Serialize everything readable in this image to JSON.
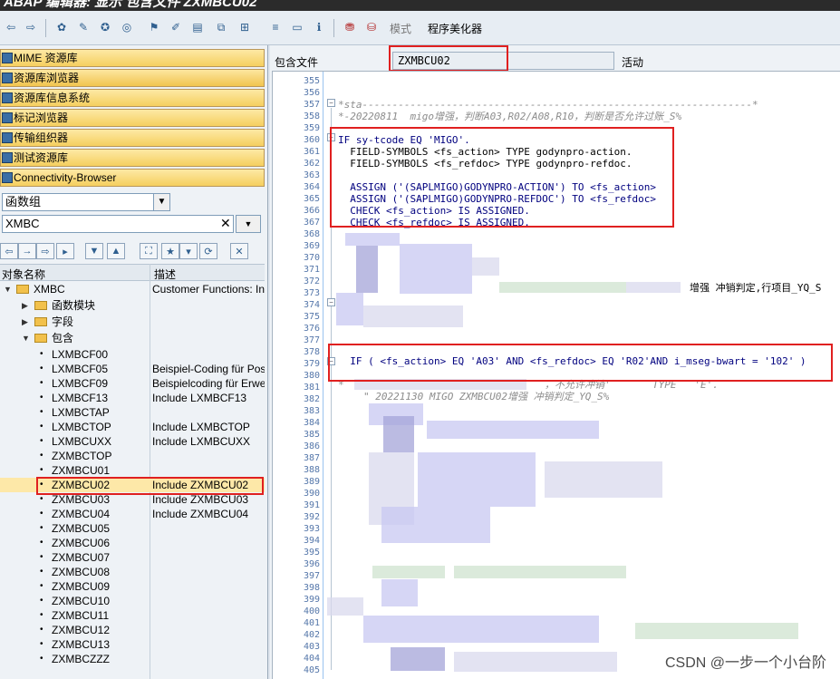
{
  "window": {
    "title": "ABAP 编辑器: 显示 包含文件 ZXMBCU02"
  },
  "toolbar": {
    "mode_label": "模式",
    "pretty_printer_label": "程序美化器"
  },
  "left_nav": {
    "items": [
      {
        "label": "MIME 资源库"
      },
      {
        "label": "资源库浏览器"
      },
      {
        "label": "资源库信息系统"
      },
      {
        "label": "标记浏览器"
      },
      {
        "label": "传输组织器"
      },
      {
        "label": "测试资源库"
      },
      {
        "label": "Connectivity-Browser"
      }
    ],
    "object_type": "函数组",
    "search_value": "XMBC"
  },
  "tree": {
    "col_name": "对象名称",
    "col_desc": "描述",
    "rows": [
      {
        "name": "XMBC",
        "desc": "Customer Functions: In"
      },
      {
        "name": "函数模块",
        "desc": ""
      },
      {
        "name": "字段",
        "desc": ""
      },
      {
        "name": "包含",
        "desc": ""
      },
      {
        "name": "LXMBCF00",
        "desc": ""
      },
      {
        "name": "LXMBCF05",
        "desc": "Beispiel-Coding für Posi"
      },
      {
        "name": "LXMBCF09",
        "desc": "Beispielcoding für Erwe"
      },
      {
        "name": "LXMBCF13",
        "desc": "Include LXMBCF13"
      },
      {
        "name": "LXMBCTAP",
        "desc": ""
      },
      {
        "name": "LXMBCTOP",
        "desc": "Include LXMBCTOP"
      },
      {
        "name": "LXMBCUXX",
        "desc": "Include LXMBCUXX"
      },
      {
        "name": "ZXMBCTOP",
        "desc": ""
      },
      {
        "name": "ZXMBCU01",
        "desc": ""
      },
      {
        "name": "ZXMBCU02",
        "desc": "Include ZXMBCU02"
      },
      {
        "name": "ZXMBCU03",
        "desc": "Include ZXMBCU03"
      },
      {
        "name": "ZXMBCU04",
        "desc": "Include ZXMBCU04"
      },
      {
        "name": "ZXMBCU05",
        "desc": ""
      },
      {
        "name": "ZXMBCU06",
        "desc": ""
      },
      {
        "name": "ZXMBCU07",
        "desc": ""
      },
      {
        "name": "ZXMBCU08",
        "desc": ""
      },
      {
        "name": "ZXMBCU09",
        "desc": ""
      },
      {
        "name": "ZXMBCU10",
        "desc": ""
      },
      {
        "name": "ZXMBCU11",
        "desc": ""
      },
      {
        "name": "ZXMBCU12",
        "desc": ""
      },
      {
        "name": "ZXMBCU13",
        "desc": ""
      },
      {
        "name": "ZXMBCZZZ",
        "desc": ""
      }
    ]
  },
  "editor": {
    "pkg_label": "包含文件",
    "pkg_value": "ZXMBCU02",
    "status": "活动",
    "line_numbers": [
      "355",
      "356",
      "357",
      "358",
      "359",
      "360",
      "361",
      "362",
      "363",
      "364",
      "365",
      "366",
      "367",
      "368",
      "369",
      "370",
      "371",
      "372",
      "373",
      "374",
      "375",
      "376",
      "377",
      "378",
      "379",
      "380",
      "381",
      "382",
      "383",
      "384",
      "385",
      "386",
      "387",
      "388",
      "389",
      "390",
      "391",
      "392",
      "393",
      "394",
      "395",
      "396",
      "397",
      "398",
      "399",
      "400",
      "401",
      "402",
      "403",
      "404",
      "405"
    ],
    "lines": {
      "l357": "*sta-----------------------------------------------------------------*",
      "l358": "*-20220811  migo增强，判断A03,R02/A08,R10，判断是否允许过账_S%",
      "l360": "IF sy-tcode EQ 'MIGO'.",
      "l361": "  FIELD-SYMBOLS <fs_action> TYPE godynpro-action.",
      "l362": "  FIELD-SYMBOLS <fs_refdoc> TYPE godynpro-refdoc.",
      "l364": "  ASSIGN ('(SAPLMIGO)GODYNPRO-ACTION') TO <fs_action>",
      "l365": "  ASSIGN ('(SAPLMIGO)GODYNPRO-REFDOC') TO <fs_refdoc>",
      "l366": "  CHECK <fs_action> IS ASSIGNED.",
      "l367": "  CHECK <fs_refdoc> IS ASSIGNED.",
      "l373": "增强 冲销判定,行项目_YQ_S",
      "l379": "  IF ( <fs_action> EQ 'A03' AND <fs_refdoc> EQ 'R02'AND i_mseg-bwart = '102' )",
      "l381": "*",
      "l381b": "，不允许冲销'       TYPE   'E'.",
      "l382": "\" 20221130 MIGO ZXMBCU02增强 冲销判定_YQ_S%"
    }
  },
  "watermark": "CSDN @一步一个小台阶"
}
